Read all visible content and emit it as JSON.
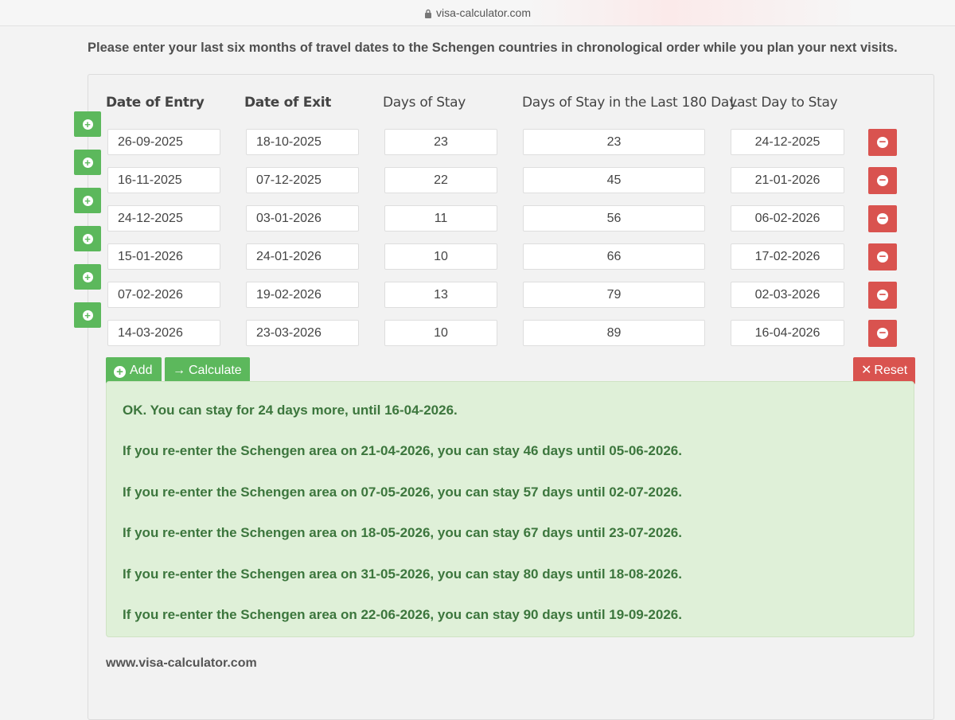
{
  "browser": {
    "url": "visa-calculator.com"
  },
  "intro_text": "Please enter your last six months of travel dates to the Schengen countries in chronological order while you plan your next visits.",
  "table": {
    "headers": {
      "entry": "Date of Entry",
      "exit": "Date of Exit",
      "days": "Days of Stay",
      "days180": "Days of Stay in the Last 180 Day",
      "lastday": "Last Day to Stay"
    },
    "rows": [
      {
        "entry": "26-09-2025",
        "exit": "18-10-2025",
        "days": "23",
        "days180": "23",
        "lastday": "24-12-2025"
      },
      {
        "entry": "16-11-2025",
        "exit": "07-12-2025",
        "days": "22",
        "days180": "45",
        "lastday": "21-01-2026"
      },
      {
        "entry": "24-12-2025",
        "exit": "03-01-2026",
        "days": "11",
        "days180": "56",
        "lastday": "06-02-2026"
      },
      {
        "entry": "15-01-2026",
        "exit": "24-01-2026",
        "days": "10",
        "days180": "66",
        "lastday": "17-02-2026"
      },
      {
        "entry": "07-02-2026",
        "exit": "19-02-2026",
        "days": "13",
        "days180": "79",
        "lastday": "02-03-2026"
      },
      {
        "entry": "14-03-2026",
        "exit": "23-03-2026",
        "days": "10",
        "days180": "89",
        "lastday": "16-04-2026"
      }
    ]
  },
  "buttons": {
    "add": "Add",
    "calculate": "Calculate",
    "reset": "Reset"
  },
  "results": [
    "OK. You can stay for 24 days more, until 16-04-2026.",
    "If you re-enter the Schengen area on 21-04-2026, you can stay 46 days until 05-06-2026.",
    "If you re-enter the Schengen area on 07-05-2026, you can stay 57 days until 02-07-2026.",
    "If you re-enter the Schengen area on 18-05-2026, you can stay 67 days until 23-07-2026.",
    "If you re-enter the Schengen area on 31-05-2026, you can stay 80 days until 18-08-2026.",
    "If you re-enter the Schengen area on 22-06-2026, you can stay 90 days until 19-09-2026."
  ],
  "footer": "www.visa-calculator.com",
  "colors": {
    "green": "#5cb85c",
    "red": "#d9534f",
    "result_bg": "#dff0d8",
    "result_text": "#3c763d"
  }
}
